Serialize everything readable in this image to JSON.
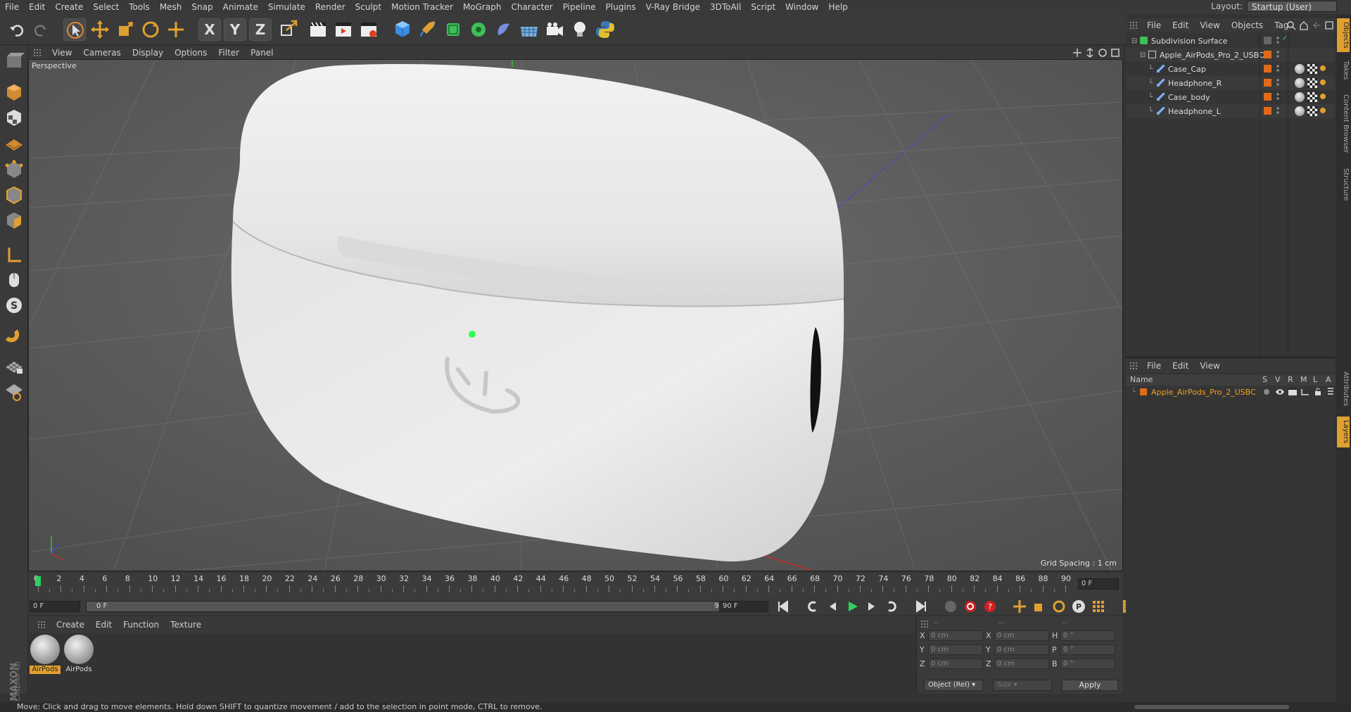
{
  "menubar": {
    "items": [
      "File",
      "Edit",
      "Create",
      "Select",
      "Tools",
      "Mesh",
      "Snap",
      "Animate",
      "Simulate",
      "Render",
      "Sculpt",
      "Motion Tracker",
      "MoGraph",
      "Character",
      "Pipeline",
      "Plugins",
      "V-Ray Bridge",
      "3DToAll",
      "Script",
      "Window",
      "Help"
    ],
    "layout_label": "Layout:",
    "layout_value": "Startup (User)"
  },
  "toolbar": {
    "axis_x": "X",
    "axis_y": "Y",
    "axis_z": "Z"
  },
  "viewport": {
    "menu": [
      "View",
      "Cameras",
      "Display",
      "Options",
      "Filter",
      "Panel"
    ],
    "camera_label": "Perspective",
    "grid_spacing": "Grid Spacing : 1 cm"
  },
  "timeline": {
    "ticks": [
      "0",
      "2",
      "4",
      "6",
      "8",
      "10",
      "12",
      "14",
      "16",
      "18",
      "20",
      "22",
      "24",
      "26",
      "28",
      "30",
      "32",
      "34",
      "36",
      "38",
      "40",
      "42",
      "44",
      "46",
      "48",
      "50",
      "52",
      "54",
      "56",
      "58",
      "60",
      "62",
      "64",
      "66",
      "68",
      "70",
      "72",
      "74",
      "76",
      "78",
      "80",
      "82",
      "84",
      "86",
      "88",
      "90"
    ],
    "current_frame": "0 F",
    "start_field": "0 F",
    "range_start": "0 F",
    "range_end": "90 F",
    "end_field": "90 F"
  },
  "materials": {
    "menu": [
      "Create",
      "Edit",
      "Function",
      "Texture"
    ],
    "items": [
      {
        "label": "AirPods",
        "selected": true
      },
      {
        "label": "AirPods",
        "selected": false
      }
    ]
  },
  "coords": {
    "headers": [
      "--",
      "--",
      "--"
    ],
    "rows": [
      {
        "a": "X",
        "av": "0 cm",
        "b": "X",
        "bv": "0 cm",
        "c": "H",
        "cv": "0 °"
      },
      {
        "a": "Y",
        "av": "0 cm",
        "b": "Y",
        "bv": "0 cm",
        "c": "P",
        "cv": "0 °"
      },
      {
        "a": "Z",
        "av": "0 cm",
        "b": "Z",
        "bv": "0 cm",
        "c": "B",
        "cv": "0 °"
      }
    ],
    "mode": "Object (Rel)",
    "size": "Size",
    "apply": "Apply"
  },
  "objects": {
    "menu": [
      "File",
      "Edit",
      "View",
      "Objects",
      "Tag"
    ],
    "tree": [
      {
        "name": "Subdivision Surface",
        "indent": 0,
        "type": "subdiv"
      },
      {
        "name": "Apple_AirPods_Pro_2_USBC",
        "indent": 1,
        "type": "null"
      },
      {
        "name": "Case_Cap",
        "indent": 2,
        "type": "mesh"
      },
      {
        "name": "Headphone_R",
        "indent": 2,
        "type": "mesh"
      },
      {
        "name": "Case_body",
        "indent": 2,
        "type": "mesh"
      },
      {
        "name": "Headphone_L",
        "indent": 2,
        "type": "mesh"
      }
    ]
  },
  "layers": {
    "menu": [
      "File",
      "Edit",
      "View"
    ],
    "columns": [
      "Name",
      "S",
      "V",
      "R",
      "M",
      "L",
      "A"
    ],
    "rows": [
      {
        "name": "Apple_AirPods_Pro_2_USBC"
      }
    ]
  },
  "sidetabs": [
    "Objects",
    "Takes",
    "Content Browser",
    "Structure",
    "Attributes",
    "Layers"
  ],
  "status": "Move: Click and drag to move elements. Hold down SHIFT to quantize movement / add to the selection in point mode, CTRL to remove.",
  "brand": {
    "line1": "MAXON",
    "line2": "CINEMA 4D"
  },
  "colors": {
    "accent": "#e0a030",
    "selection": "#f0a020",
    "layer": "#e06a1a"
  }
}
